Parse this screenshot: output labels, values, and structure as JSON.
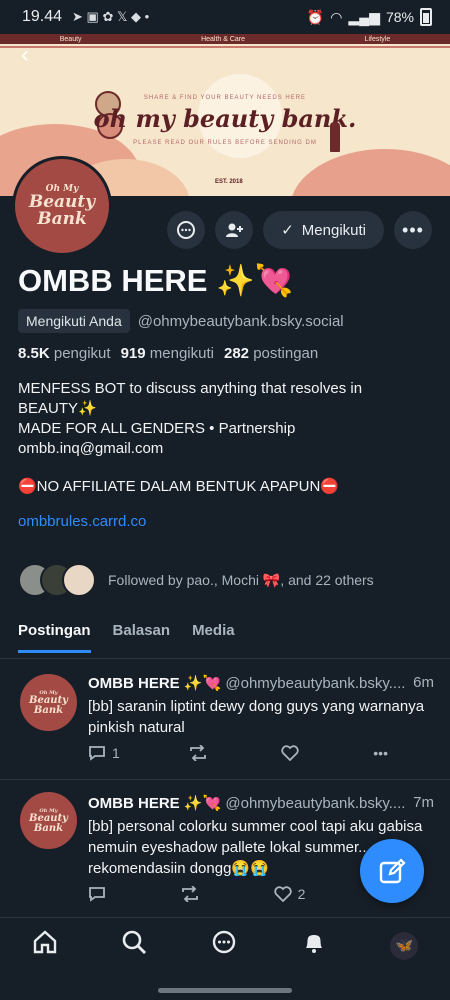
{
  "status_bar": {
    "time": "19.44",
    "battery": "78%"
  },
  "banner": {
    "nav": [
      "Beauty",
      "Health & Care",
      "Lifestyle"
    ],
    "tagline": "SHARE & FIND YOUR BEAUTY NEEDS HERE",
    "logo_text": "oh my beauty bank.",
    "subtag": "PLEASE READ OUR RULES BEFORE SENDING DM",
    "est": "EST. 2018"
  },
  "avatar": {
    "line1": "Oh My",
    "line2": "Beauty",
    "line3": "Bank"
  },
  "profile": {
    "follow_label": "Mengikuti",
    "name": "OMBB HERE ✨💘",
    "follows_you": "Mengikuti Anda",
    "handle": "@ohmybeautybank.bsky.social",
    "followers_count": "8.5K",
    "followers_label": "pengikut",
    "following_count": "919",
    "following_label": "mengikuti",
    "posts_count": "282",
    "posts_label": "postingan",
    "bio_1": "MENFESS BOT to discuss anything that resolves in BEAUTY✨",
    "bio_2": "MADE FOR ALL GENDERS  • Partnership",
    "bio_3": "ombb.inq@gmail.com",
    "bio_4": "⛔NO AFFILIATE DALAM BENTUK APAPUN⛔",
    "link": "ombbrules.carrd.co",
    "followed_by": "Followed by pao., Mochi 🎀, and 22 others"
  },
  "tabs": [
    "Postingan",
    "Balasan",
    "Media"
  ],
  "posts": [
    {
      "name": "OMBB HERE ✨💘",
      "handle": "@ohmybeautybank.bsky....",
      "time": "6m",
      "text": "[bb] saranin liptint dewy dong guys yang warnanya pinkish natural",
      "replies": "1",
      "reposts": "",
      "likes": ""
    },
    {
      "name": "OMBB HERE ✨💘",
      "handle": "@ohmybeautybank.bsky....",
      "time": "7m",
      "text": "[bb] personal colorku summer cool tapi aku gabisa nemuin eyeshadow pallete lokal summer... rekomendasiin dongg😭😭",
      "replies": "",
      "reposts": "",
      "likes": "2"
    }
  ]
}
